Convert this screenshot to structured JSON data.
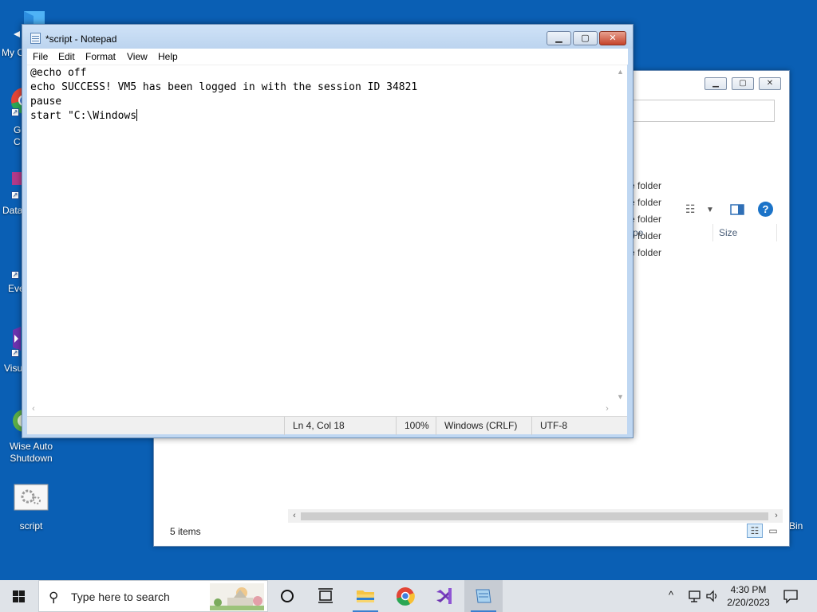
{
  "desktop": {
    "icons": [
      {
        "label": "My C"
      },
      {
        "label": "G"
      },
      {
        "label": "C"
      },
      {
        "label": "Data"
      },
      {
        "label": "Eve"
      },
      {
        "label": "Visu"
      },
      {
        "label": "Wise Auto"
      },
      {
        "label": "Shutdown"
      },
      {
        "label": "script"
      },
      {
        "label": "Bin"
      }
    ]
  },
  "explorer": {
    "column_type": "pe",
    "column_size": "Size",
    "rows": [
      "e folder",
      "e folder",
      "e folder",
      "e folder",
      "e folder"
    ],
    "status": "5 items"
  },
  "notepad": {
    "title": "*script - Notepad",
    "menu": [
      "File",
      "Edit",
      "Format",
      "View",
      "Help"
    ],
    "content_lines": [
      "@echo off",
      "echo SUCCESS! VM5 has been logged in with the session ID 34821",
      "pause",
      "start \"C:\\Windows"
    ],
    "status": {
      "position": "Ln 4, Col 18",
      "zoom": "100%",
      "line_ending": "Windows (CRLF)",
      "encoding": "UTF-8"
    }
  },
  "taskbar": {
    "search_placeholder": "Type here to search",
    "time": "4:30 PM",
    "date": "2/20/2023"
  },
  "colors": {
    "desktop": "#0a5fb4",
    "notepad_frame": "#bfd7f2",
    "taskbar": "#dfe3e8",
    "close_button": "#c5432b"
  }
}
